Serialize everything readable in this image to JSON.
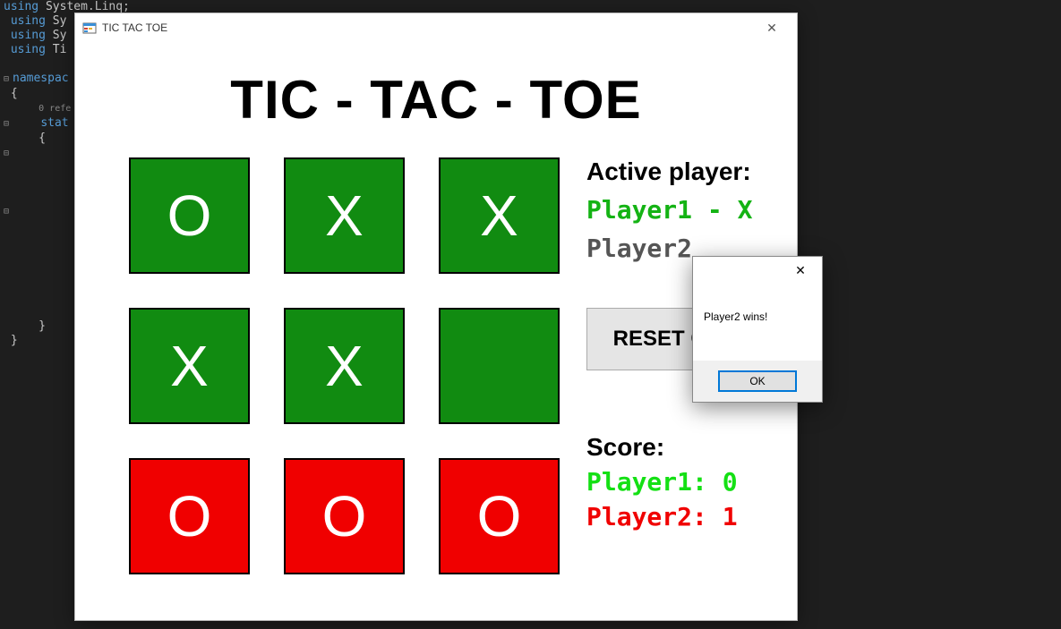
{
  "editor": {
    "lines": [
      "using System.Linq;",
      "using Sy",
      "using Sy",
      "using Ti",
      "",
      "namespac",
      "{",
      "    0 refe",
      "    stat",
      "    {",
      "",
      "",
      "",
      "",
      "",
      "",
      "",
      "",
      "",
      "",
      "",
      "",
      "",
      "    }",
      "}"
    ]
  },
  "window": {
    "title": "TIC TAC TOE"
  },
  "game": {
    "title": "TIC - TAC - TOE",
    "cells": [
      {
        "mark": "O",
        "win": false
      },
      {
        "mark": "X",
        "win": false
      },
      {
        "mark": "X",
        "win": false
      },
      {
        "mark": "X",
        "win": false
      },
      {
        "mark": "X",
        "win": false
      },
      {
        "mark": "",
        "win": false
      },
      {
        "mark": "O",
        "win": true
      },
      {
        "mark": "O",
        "win": true
      },
      {
        "mark": "O",
        "win": true
      }
    ],
    "active_label": "Active player:",
    "player1_line": "Player1 - X",
    "player2_line": "Player2",
    "reset_label": "RESET GAME",
    "score_label": "Score:",
    "score_p1": "Player1:  0",
    "score_p2": "Player2:  1"
  },
  "dialog": {
    "message": "Player2 wins!",
    "ok_label": "OK"
  }
}
